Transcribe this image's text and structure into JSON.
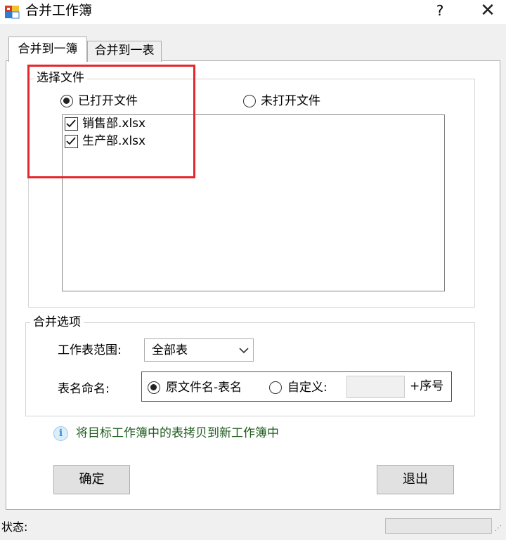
{
  "window": {
    "title": "合并工作簿",
    "help": "?",
    "close": "✕"
  },
  "tabs": [
    {
      "label": "合并到一簿",
      "active": true
    },
    {
      "label": "合并到一表",
      "active": false
    }
  ],
  "select_files": {
    "group_label": "选择文件",
    "opened_option": {
      "label": "已打开文件",
      "selected": true
    },
    "unopened_option": {
      "label": "未打开文件",
      "selected": false
    },
    "files": [
      {
        "name": "销售部.xlsx",
        "checked": true
      },
      {
        "name": "生产部.xlsx",
        "checked": true
      }
    ]
  },
  "merge_options": {
    "group_label": "合并选项",
    "sheet_range_label": "工作表范围:",
    "sheet_range_value": "全部表",
    "naming_label": "表名命名:",
    "naming_original": {
      "label": "原文件名-表名",
      "selected": true
    },
    "naming_custom": {
      "label": "自定义:",
      "selected": false
    },
    "custom_value": "",
    "suffix_label": "+序号"
  },
  "info_text": "将目标工作簿中的表拷贝到新工作簿中",
  "buttons": {
    "ok": "确定",
    "exit": "退出"
  },
  "status": {
    "label": "状态:"
  },
  "colors": {
    "highlight_box": "#e5262b",
    "info_text": "#1e5c1e",
    "info_icon": "#3a8fd6"
  }
}
